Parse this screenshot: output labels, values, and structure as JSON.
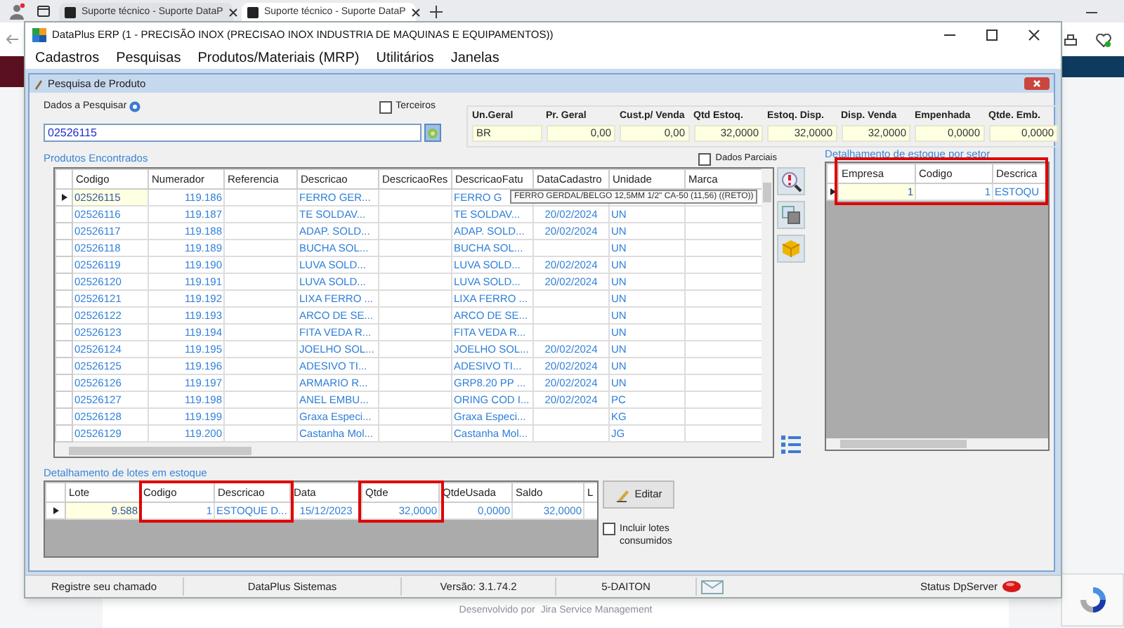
{
  "browser": {
    "tabs": [
      {
        "title": "Suporte técnico - Suporte DataP",
        "selected": false
      },
      {
        "title": "Suporte técnico - Suporte DataP",
        "selected": true
      }
    ],
    "footer": [
      "Desenvolvido por",
      "Jira Service Management"
    ]
  },
  "window": {
    "title": "DataPlus ERP (1 - PRECISÃO INOX  (PRECISAO INOX INDUSTRIA DE MAQUINAS E EQUIPAMENTOS))"
  },
  "menu": [
    "Cadastros",
    "Pesquisas",
    "Produtos/Materiais (MRP)",
    "Utilitários",
    "Janelas"
  ],
  "dialog": {
    "title": "Pesquisa de Produto"
  },
  "search": {
    "label": "Dados a Pesquisar",
    "value": "02526115"
  },
  "terceiros": {
    "label": "Terceiros",
    "checked": false
  },
  "summary": [
    {
      "label": "Un.Geral",
      "value": "BR",
      "kind": "text"
    },
    {
      "label": "Pr. Geral",
      "value": "0,00",
      "kind": "number"
    },
    {
      "label": "Cust.p/ Venda",
      "value": "0,00",
      "kind": "number"
    },
    {
      "label": "Qtd Estoq.",
      "value": "32,0000",
      "kind": "number"
    },
    {
      "label": "Estoq. Disp.",
      "value": "32,0000",
      "kind": "number"
    },
    {
      "label": "Disp. Venda",
      "value": "32,0000",
      "kind": "number"
    },
    {
      "label": "Empenhada",
      "value": "0,0000",
      "kind": "number"
    },
    {
      "label": "Qtde. Emb.",
      "value": "0,0000",
      "kind": "number"
    }
  ],
  "products": {
    "title": "Produtos Encontrados",
    "partial": {
      "label": "Dados Parciais",
      "checked": false
    },
    "columns": [
      "Codigo",
      "Numerador",
      "Referencia",
      "Descricao",
      "DescricaoRes",
      "DescricaoFatu",
      "DataCadastro",
      "Unidade",
      "Marca"
    ],
    "rows": [
      {
        "selected": true,
        "cells": [
          "02526115",
          "119.186",
          null,
          "FERRO GER...",
          null,
          "FERRO G",
          null,
          null,
          null
        ]
      },
      {
        "selected": false,
        "cells": [
          "02526116",
          "119.187",
          null,
          "TE SOLDAV...",
          null,
          "TE SOLDAV...",
          "20/02/2024",
          "UN",
          null
        ]
      },
      {
        "selected": false,
        "cells": [
          "02526117",
          "119.188",
          null,
          "ADAP. SOLD...",
          null,
          "ADAP. SOLD...",
          "20/02/2024",
          "UN",
          null
        ]
      },
      {
        "selected": false,
        "cells": [
          "02526118",
          "119.189",
          null,
          "BUCHA SOL...",
          null,
          "BUCHA SOL...",
          null,
          "UN",
          null
        ]
      },
      {
        "selected": false,
        "cells": [
          "02526119",
          "119.190",
          null,
          "LUVA SOLD...",
          null,
          "LUVA SOLD...",
          "20/02/2024",
          "UN",
          null
        ]
      },
      {
        "selected": false,
        "cells": [
          "02526120",
          "119.191",
          null,
          "LUVA SOLD...",
          null,
          "LUVA SOLD...",
          "20/02/2024",
          "UN",
          null
        ]
      },
      {
        "selected": false,
        "cells": [
          "02526121",
          "119.192",
          null,
          "LIXA FERRO ...",
          null,
          "LIXA FERRO ...",
          null,
          "UN",
          null
        ]
      },
      {
        "selected": false,
        "cells": [
          "02526122",
          "119.193",
          null,
          "ARCO DE SE...",
          null,
          "ARCO DE SE...",
          null,
          "UN",
          null
        ]
      },
      {
        "selected": false,
        "cells": [
          "02526123",
          "119.194",
          null,
          "FITA VEDA R...",
          null,
          "FITA VEDA R...",
          null,
          "UN",
          null
        ]
      },
      {
        "selected": false,
        "cells": [
          "02526124",
          "119.195",
          null,
          "JOELHO SOL...",
          null,
          "JOELHO SOL...",
          "20/02/2024",
          "UN",
          null
        ]
      },
      {
        "selected": false,
        "cells": [
          "02526125",
          "119.196",
          null,
          "ADESIVO TI...",
          null,
          "ADESIVO TI...",
          "20/02/2024",
          "UN",
          null
        ]
      },
      {
        "selected": false,
        "cells": [
          "02526126",
          "119.197",
          null,
          "ARMARIO R...",
          null,
          "GRP8.20 PP ...",
          "20/02/2024",
          "UN",
          null
        ]
      },
      {
        "selected": false,
        "cells": [
          "02526127",
          "119.198",
          null,
          "ANEL EMBU...",
          null,
          "ORING COD I...",
          "20/02/2024",
          "PC",
          null
        ]
      },
      {
        "selected": false,
        "cells": [
          "02526128",
          "119.199",
          null,
          "Graxa Especi...",
          null,
          "Graxa Especi...",
          null,
          "KG",
          null
        ]
      },
      {
        "selected": false,
        "cells": [
          "02526129",
          "119.200",
          null,
          "Castanha Mol...",
          null,
          "Castanha Mol...",
          null,
          "JG",
          null
        ]
      }
    ],
    "tooltip": "FERRO GERDAL/BELGO 12,5MM 1/2\" CA-50 (11,56) ((RETO))"
  },
  "sector": {
    "title": "Detalhamento de estoque por setor",
    "columns": [
      "Empresa",
      "Codigo",
      "Descrica"
    ],
    "rows": [
      {
        "selected": true,
        "cells": [
          "1",
          "1",
          "ESTOQU"
        ]
      }
    ]
  },
  "lots": {
    "title": "Detalhamento de lotes em estoque",
    "columns": [
      "Lote",
      "Codigo",
      "Descricao",
      "Data",
      "Qtde",
      "QtdeUsada",
      "Saldo",
      "L"
    ],
    "rows": [
      {
        "selected": true,
        "cells": [
          "9.588",
          "1",
          "ESTOQUE D...",
          "15/12/2023",
          "32,0000",
          "0,0000",
          "32,0000",
          null
        ]
      }
    ],
    "edit_button": "Editar",
    "include": {
      "label": "Incluir lotes consumidos",
      "checked": false
    }
  },
  "status_bar": {
    "items": [
      "Registre seu chamado",
      "DataPlus Sistemas",
      "Versão: 3.1.74.2",
      "5-DAITON"
    ],
    "server": "Status DpServer"
  }
}
